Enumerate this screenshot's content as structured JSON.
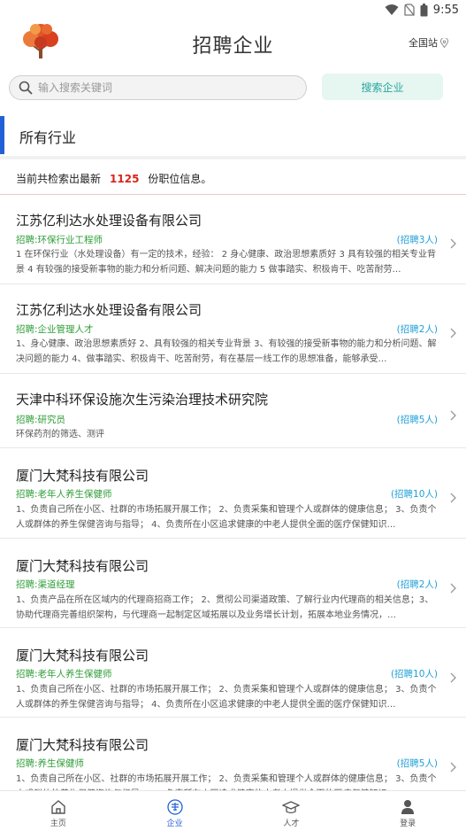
{
  "status_bar": {
    "time": "9:55"
  },
  "header": {
    "title": "招聘企业",
    "site_label": "全国站"
  },
  "search": {
    "placeholder": "输入搜索关键词",
    "value": "",
    "button_label": "搜索企业"
  },
  "section": {
    "title": "所有行业"
  },
  "results": {
    "prefix": "当前共检索出最新",
    "count": "1125",
    "suffix": "份职位信息。"
  },
  "jobs": [
    {
      "company": "江苏亿利达水处理设备有限公司",
      "position": "招聘:环保行业工程师",
      "hiring": "(招聘3人)",
      "desc": "1 在环保行业（水处理设备）有一定的技术，经验： 2 身心健康、政治思想素质好 3 具有较强的相关专业背景 4 有较强的接受新事物的能力和分析问题、解决问题的能力 5 做事踏实、积极肯干、吃苦耐劳…"
    },
    {
      "company": "江苏亿利达水处理设备有限公司",
      "position": "招聘:企业管理人才",
      "hiring": "(招聘2人)",
      "desc": "1、身心健康、政治思想素质好 2、具有较强的相关专业背景 3、有较强的接受新事物的能力和分析问题、解决问题的能力 4、做事踏实、积极肯干、吃苦耐劳，有在基层一线工作的思想准备，能够承受…"
    },
    {
      "company": "天津中科环保设施次生污染治理技术研究院",
      "position": "招聘:研究员",
      "hiring": "(招聘5人)",
      "desc": "环保药剂的筛选、测评"
    },
    {
      "company": "厦门大梵科技有限公司",
      "position": "招聘:老年人养生保健师",
      "hiring": "(招聘10人)",
      "desc": "1、负责自己所在小区、社群的市场拓展开展工作； 2、负责采集和管理个人或群体的健康信息； 3、负责个人或群体的养生保健咨询与指导； 4、负责所在小区追求健康的中老人提供全面的医疗保健知识…"
    },
    {
      "company": "厦门大梵科技有限公司",
      "position": "招聘:渠道经理",
      "hiring": "(招聘2人)",
      "desc": "1、负责产品在所在区域内的代理商招商工作； 2、贯彻公司渠道政策、了解行业内代理商的相关信息；3、协助代理商完善组织架构，与代理商一起制定区域拓展以及业务增长计划，拓展本地业务情况，…"
    },
    {
      "company": "厦门大梵科技有限公司",
      "position": "招聘:老年人养生保健师",
      "hiring": "(招聘10人)",
      "desc": "1、负责自己所在小区、社群的市场拓展开展工作； 2、负责采集和管理个人或群体的健康信息； 3、负责个人或群体的养生保健咨询与指导； 4、负责所在小区追求健康的中老人提供全面的医疗保健知识…"
    },
    {
      "company": "厦门大梵科技有限公司",
      "position": "招聘:养生保健师",
      "hiring": "(招聘5人)",
      "desc": "1、负责自己所在小区、社群的市场拓展开展工作； 2、负责采集和管理个人或群体的健康信息； 3、负责个人或群体的养生保健咨询与指导； 4、负责所在小区追求健康的中老人提供全面的医疗保健知识…"
    }
  ],
  "nav": [
    {
      "label": "主页",
      "icon": "home-icon"
    },
    {
      "label": "企业",
      "icon": "company-icon"
    },
    {
      "label": "人才",
      "icon": "talent-icon"
    },
    {
      "label": "登录",
      "icon": "user-icon"
    }
  ],
  "colors": {
    "accent": "#2160d6",
    "count": "#d9251b",
    "position": "#2e9d38",
    "hiring": "#1f9fd6",
    "search_button_bg": "#e6f6f0"
  }
}
